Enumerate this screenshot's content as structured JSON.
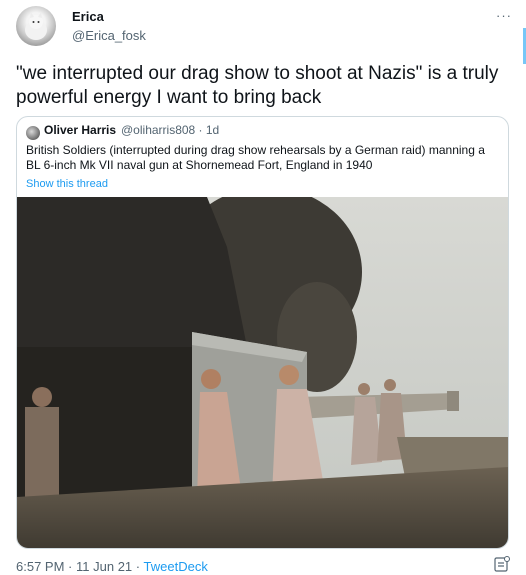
{
  "tweet": {
    "author_name": "Erica",
    "author_handle": "@Erica_fosk",
    "more_label": "···",
    "text": "\"we interrupted our drag show to shoot at Nazis\" is a truly powerful energy I want to bring back",
    "time": "6:57 PM",
    "date": "11 Jun 21",
    "client": "TweetDeck",
    "separator": "·"
  },
  "quote": {
    "author_name": "Oliver Harris",
    "handle_time": "@oliharris808 · 1d",
    "text": "British Soldiers (interrupted during drag show rehearsals by a German raid) manning a BL 6-inch Mk VII naval gun at Shornemead Fort, England in 1940",
    "show_thread": "Show this thread"
  },
  "colors": {
    "link": "#1d9bf0",
    "secondary_text": "#536471",
    "border": "#cfd9de"
  },
  "icons": {
    "avatar": "white-cat-avatar",
    "quote_avatar": "oliver-harris-avatar",
    "analytics": "analytics-icon"
  }
}
